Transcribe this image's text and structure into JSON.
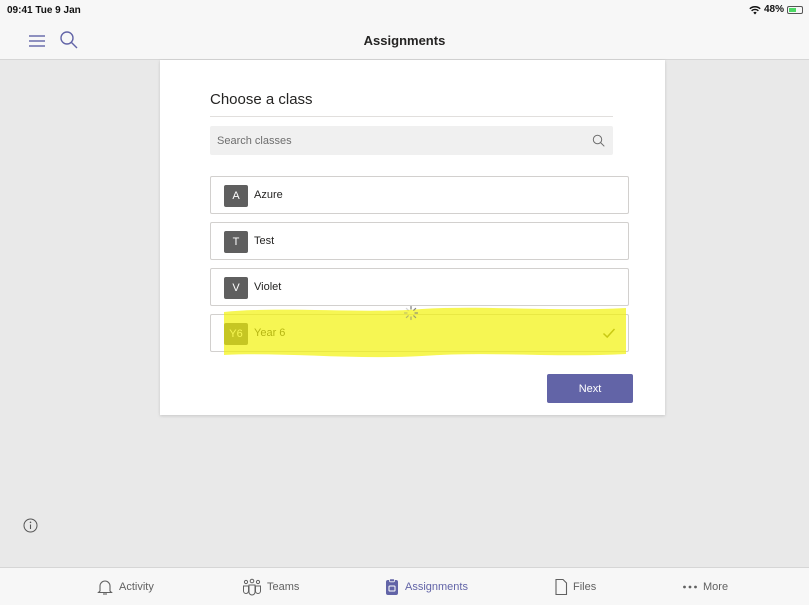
{
  "status_bar": {
    "time": "09:41  Tue 9 Jan",
    "battery_percent": "48%"
  },
  "nav": {
    "title": "Assignments",
    "menu_icon": "hamburger-menu-icon",
    "search_icon": "search-icon"
  },
  "dialog": {
    "title": "Choose a class",
    "search_placeholder": "Search classes",
    "classes": [
      {
        "initial": "A",
        "name": "Azure",
        "selected": false
      },
      {
        "initial": "T",
        "name": "Test",
        "selected": false
      },
      {
        "initial": "V",
        "name": "Violet",
        "selected": false
      },
      {
        "initial": "Y6",
        "name": "Year 6",
        "selected": true
      }
    ],
    "next_label": "Next"
  },
  "tabs": [
    {
      "label": "Activity",
      "icon": "bell-icon",
      "active": false
    },
    {
      "label": "Teams",
      "icon": "teams-icon",
      "active": false
    },
    {
      "label": "Assignments",
      "icon": "assignments-icon",
      "active": true
    },
    {
      "label": "Files",
      "icon": "file-icon",
      "active": false
    },
    {
      "label": "More",
      "icon": "more-dots-icon",
      "active": false
    }
  ],
  "colors": {
    "accent": "#6264a7",
    "highlighter": "#f2f20a",
    "avatar": "#5f5f5f"
  }
}
